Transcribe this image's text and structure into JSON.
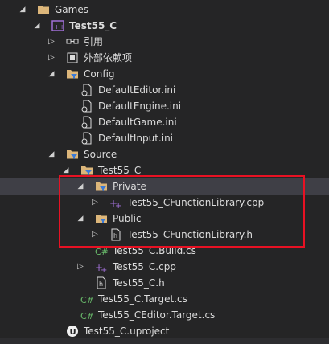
{
  "tree": {
    "games_label": "Games",
    "project_label": "Test55_C",
    "references_label": "引用",
    "external_deps_label": "外部依赖项",
    "config_label": "Config",
    "config_files": [
      "DefaultEditor.ini",
      "DefaultEngine.ini",
      "DefaultGame.ini",
      "DefaultInput.ini"
    ],
    "source_label": "Source",
    "module_label": "Test55_C",
    "private_label": "Private",
    "private_cpp_label": "Test55_CFunctionLibrary.cpp",
    "public_label": "Public",
    "public_h_label": "Test55_CFunctionLibrary.h",
    "build_cs_label": "Test55_C.Build.cs",
    "module_cpp_label": "Test55_C.cpp",
    "module_h_label": "Test55_C.h",
    "target_cs_label": "Test55_C.Target.cs",
    "editor_target_cs_label": "Test55_CEditor.Target.cs",
    "uproject_label": "Test55_C.uproject"
  },
  "colors": {
    "background": "#252526",
    "selection": "#3f3f46",
    "highlight_box": "#e81123",
    "folder": "#dcb67a",
    "cpp": "#a06fd6",
    "csharp": "#68b96a"
  }
}
